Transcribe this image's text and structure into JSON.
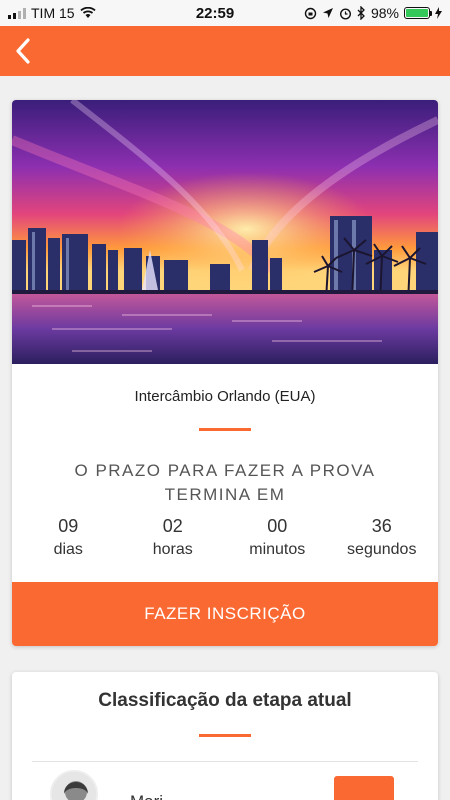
{
  "status_bar": {
    "carrier": "TIM 15",
    "time": "22:59",
    "battery_text": "98%",
    "battery_level": 0.98
  },
  "app_bar": {
    "back_icon": "chevron-left-icon",
    "color": "#fa6932"
  },
  "event": {
    "image": "orlando-skyline-sunset",
    "title": "Intercâmbio Orlando (EUA)",
    "deadline_text": "O PRAZO PARA FAZER A PROVA TERMINA EM",
    "countdown": [
      {
        "value": "09",
        "label": "dias"
      },
      {
        "value": "02",
        "label": "horas"
      },
      {
        "value": "00",
        "label": "minutos"
      },
      {
        "value": "36",
        "label": "segundos"
      }
    ],
    "cta_label": "FAZER INSCRIÇÃO"
  },
  "ranking": {
    "title": "Classificação da etapa atual",
    "first_row": {
      "name": "Mari..."
    }
  }
}
